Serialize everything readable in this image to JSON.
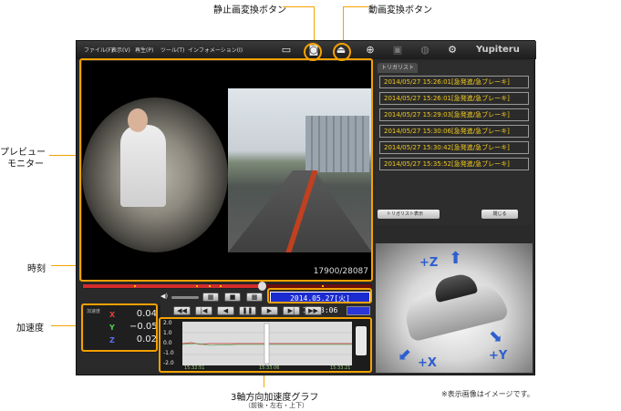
{
  "callouts": {
    "still_convert": "静止画変換ボタン",
    "video_convert": "動画変換ボタン",
    "preview_line1": "プレビュー",
    "preview_line2": "モニター",
    "time": "時刻",
    "accel": "加速度",
    "graph": "3軸方向加速度グラフ",
    "graph_sub": "（前後・左右・上下）",
    "note": "※表示画像はイメージです。"
  },
  "menu": [
    "ファイル(F)",
    "表示(V)",
    "再生(P)",
    "ツール(T)",
    "インフォメーション(I)"
  ],
  "brand": "Yupiteru",
  "toolbar_icons": [
    "folder-icon",
    "camera-icon",
    "video-export-icon",
    "zoom-icon",
    "save-icon",
    "globe-icon",
    "settings-icon"
  ],
  "video": {
    "frame_counter": "17900/28087",
    "seek_progress": 0.62
  },
  "timestamp": "2014.05.27[火] 15:33:06",
  "acceleration": {
    "title": "加速度",
    "x_label": "X",
    "x_value": "0.04",
    "y_label": "Y",
    "y_value": "−0.05",
    "z_label": "Z",
    "z_value": "0.02"
  },
  "graph": {
    "y_ticks": [
      "2.0",
      "1.0",
      "0.0",
      "-1.0",
      "-2.0"
    ],
    "x_ticks": [
      "15:32:51",
      "15:33:06",
      "15:33:21"
    ]
  },
  "trigger_list": {
    "tab_label": "トリガリスト",
    "items": [
      "2014/05/27 15:26:01[急発進/急ブレーキ]",
      "2014/05/27 15:26:01[急発進/急ブレーキ]",
      "2014/05/27 15:29:03[急発進/急ブレーキ]",
      "2014/05/27 15:30:06[急発進/急ブレーキ]",
      "2014/05/27 15:30:42[急発進/急ブレーキ]",
      "2014/05/27 15:35:52[急発進/急ブレーキ]"
    ],
    "toggle_label": "トリガリスト表示",
    "close_label": "閉じる"
  },
  "axes3d": {
    "z": "+Z",
    "x": "+X",
    "y": "+Y"
  },
  "colors": {
    "accent": "#f5a100",
    "timestamp_bg": "#1a2bd0",
    "trigger_text": "#f0c820",
    "axis_blue": "#2d5fd0"
  }
}
